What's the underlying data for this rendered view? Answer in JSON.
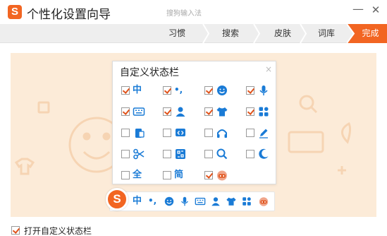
{
  "window": {
    "logo": "S",
    "title": "个性化设置向导",
    "subtitle": "搜狗输入法",
    "minimize": "—",
    "close": "✕"
  },
  "steps": [
    {
      "label": "习惯"
    },
    {
      "label": "搜索"
    },
    {
      "label": "皮肤"
    },
    {
      "label": "词库"
    },
    {
      "label": "完成",
      "active": true
    }
  ],
  "colors": {
    "accent": "#f26522",
    "icon_blue": "#1a7bd6",
    "check": "#e0521a"
  },
  "panel": {
    "title": "自定义状态栏",
    "close": "×",
    "items": [
      {
        "icon": "chinese-mode-icon",
        "checked": true,
        "glyph": "中"
      },
      {
        "icon": "punctuation-icon",
        "checked": true,
        "glyph": "•,"
      },
      {
        "icon": "emoji-icon",
        "checked": true
      },
      {
        "icon": "microphone-icon",
        "checked": true
      },
      {
        "icon": "keyboard-icon",
        "checked": true
      },
      {
        "icon": "user-icon",
        "checked": true
      },
      {
        "icon": "skin-shirt-icon",
        "checked": true
      },
      {
        "icon": "toolbox-icon",
        "checked": true
      },
      {
        "icon": "phone-icon",
        "checked": false
      },
      {
        "icon": "screenshot-icon",
        "checked": false
      },
      {
        "icon": "headphones-icon",
        "checked": false
      },
      {
        "icon": "pen-icon",
        "checked": false
      },
      {
        "icon": "scissors-icon",
        "checked": false
      },
      {
        "icon": "translate-icon",
        "checked": false
      },
      {
        "icon": "search-icon",
        "checked": false
      },
      {
        "icon": "moon-icon",
        "checked": false
      },
      {
        "icon": "full-width-icon",
        "checked": false,
        "glyph": "全"
      },
      {
        "icon": "simplified-icon",
        "checked": false,
        "glyph": "简"
      },
      {
        "icon": "mascot-icon",
        "checked": true
      }
    ]
  },
  "statusbar": {
    "logo": "S",
    "icons": [
      "chinese-mode-icon",
      "punctuation-icon",
      "emoji-icon",
      "microphone-icon",
      "keyboard-icon",
      "user-icon",
      "skin-shirt-icon",
      "toolbox-icon",
      "mascot-icon"
    ],
    "glyph_chinese": "中",
    "glyph_punct": "•,"
  },
  "bottom": {
    "label": "打开自定义状态栏",
    "checked": true
  }
}
